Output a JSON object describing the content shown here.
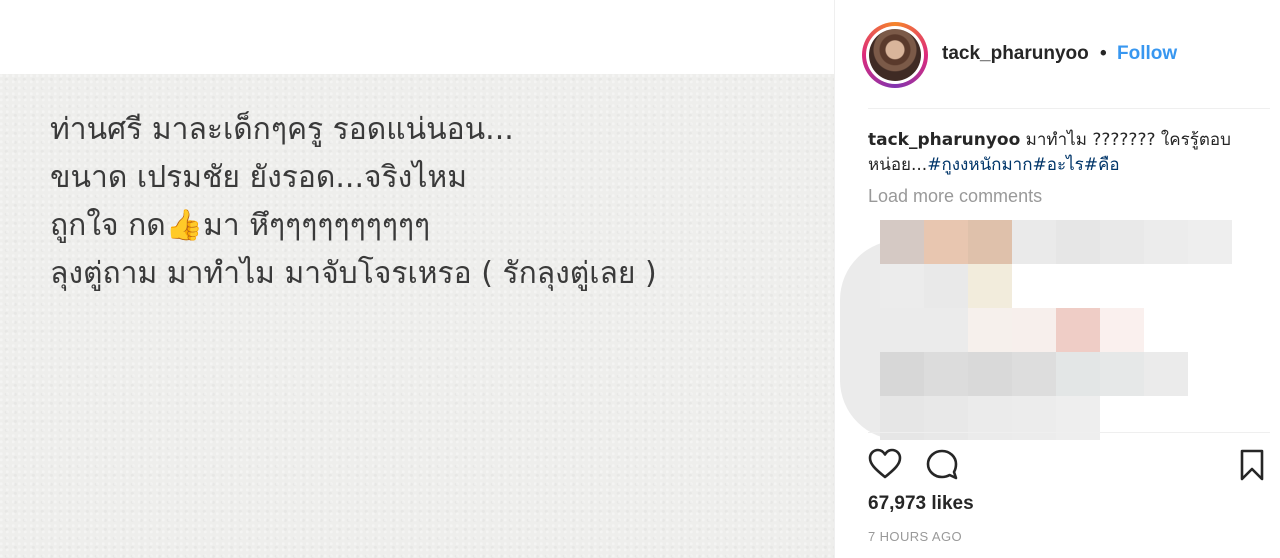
{
  "post": {
    "text_lines": [
      "ท่านศรี มาละเด็กๆครู รอดแน่นอน...",
      "ขนาด เปรมชัย ยังรอด...จริงไหม",
      "ถูกใจ กด",
      "มา หึๆๆๆๆๆๆๆๆๆๆ",
      "ลุงตู่ถาม มาทำไม มาจับโจรเหรอ ( รักลุงตู่เลย )"
    ],
    "thumb_emoji": "👍"
  },
  "header": {
    "username": "tack_pharunyoo",
    "separator": "•",
    "follow_label": "Follow"
  },
  "caption": {
    "username": "tack_pharunyoo",
    "text": "มาทำไม ??????? ใครรู้ตอบหน่อย...",
    "tags": [
      "#กูงงหนักมาก",
      "#อะไร",
      "#คือ"
    ]
  },
  "comments": {
    "load_more_label": "Load more comments"
  },
  "actions": {
    "like_icon": "heart-icon",
    "comment_icon": "comment-icon",
    "save_icon": "bookmark-icon"
  },
  "stats": {
    "likes": "67,973 likes",
    "timestamp": "7 HOURS AGO"
  },
  "colors": {
    "accent": "#3897f0",
    "hashtag": "#003569",
    "muted": "#999999",
    "text": "#262626"
  }
}
